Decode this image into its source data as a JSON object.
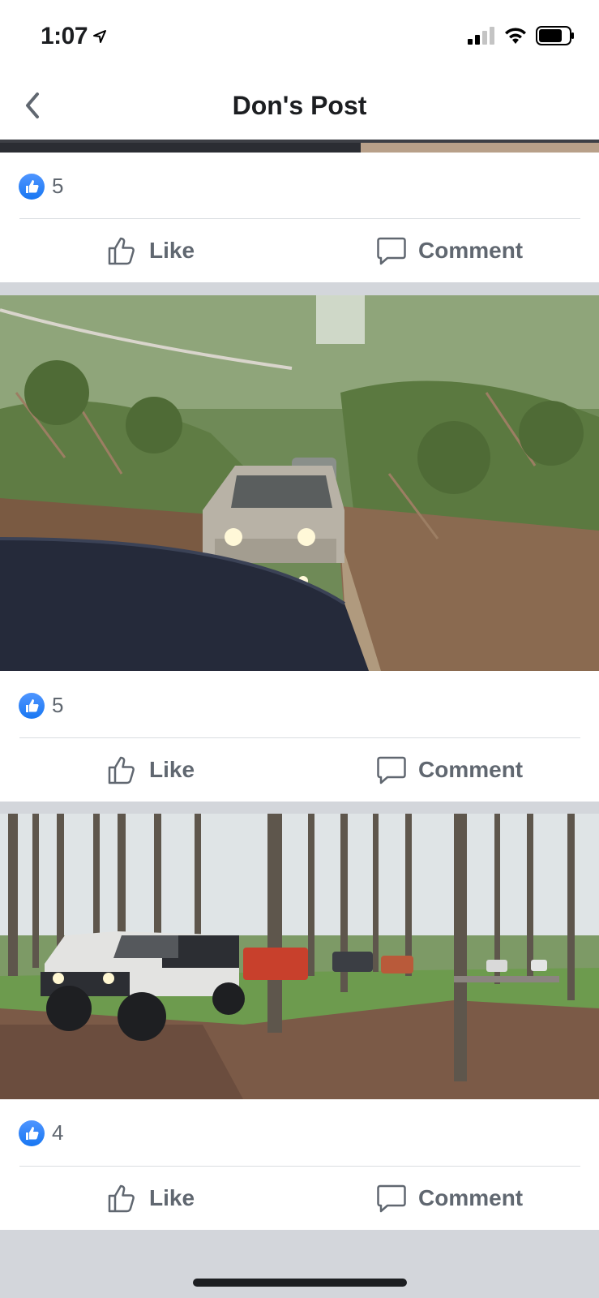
{
  "status_bar": {
    "time": "1:07"
  },
  "header": {
    "title": "Don's Post"
  },
  "posts": [
    {
      "like_count": "5",
      "like_label": "Like",
      "comment_label": "Comment"
    },
    {
      "like_count": "5",
      "like_label": "Like",
      "comment_label": "Comment"
    },
    {
      "like_count": "4",
      "like_label": "Like",
      "comment_label": "Comment"
    }
  ],
  "colors": {
    "accent": "#1877f2",
    "separator": "#d3d6db",
    "action_text": "#606770"
  }
}
